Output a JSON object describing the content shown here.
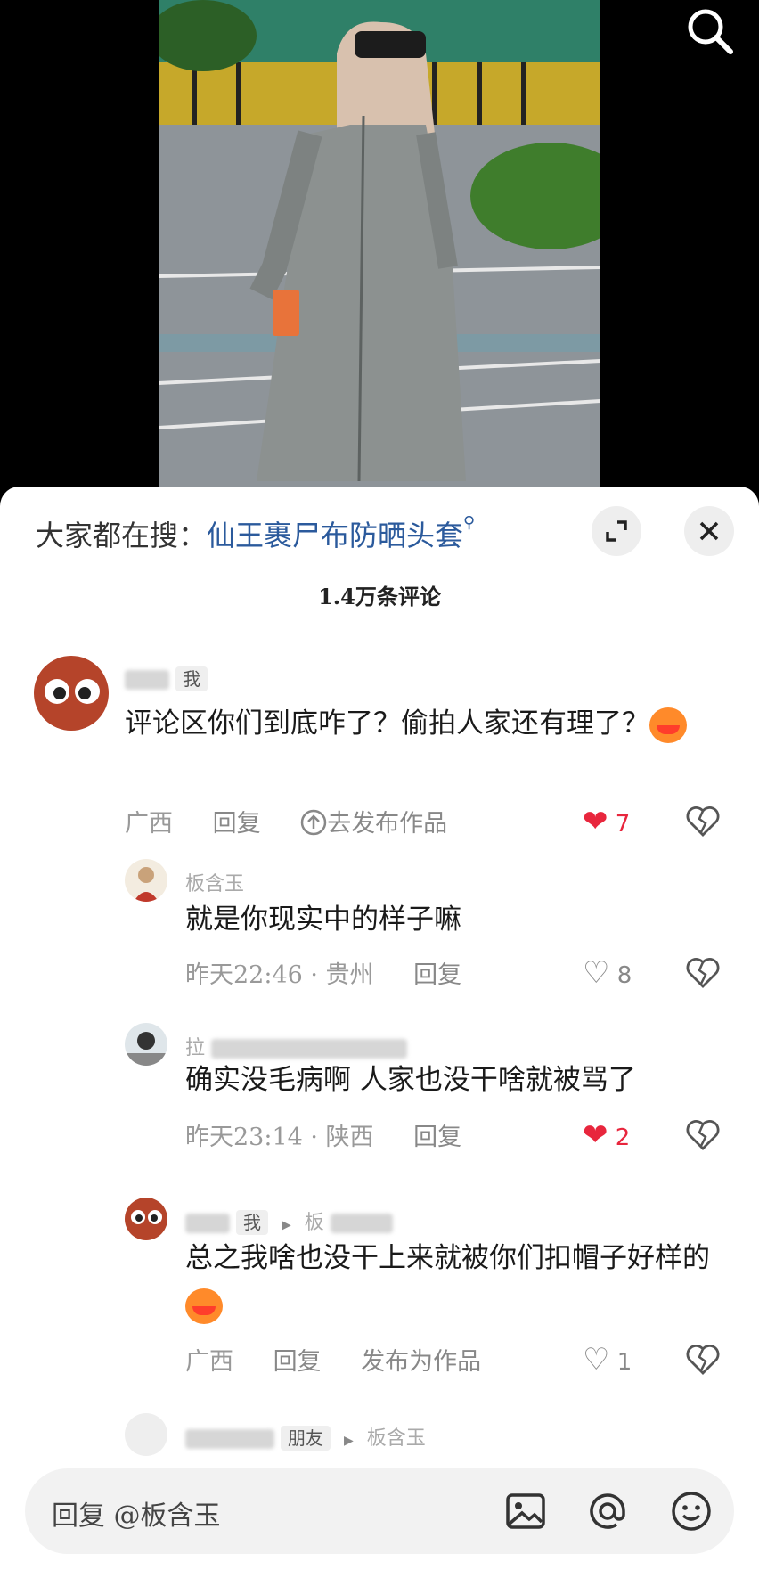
{
  "video": {
    "search_icon": "search-icon"
  },
  "sheet": {
    "trend_prefix": "大家都在搜：",
    "trend_keyword": "仙王裹尸布防晒头套",
    "comment_count": "1.4万条评论"
  },
  "comments": [
    {
      "tag": "我",
      "text": "评论区你们到底咋了？偷拍人家还有理了？",
      "location": "广西",
      "reply": "回复",
      "action": "去发布作品",
      "likes": "7",
      "liked": true
    },
    {
      "user": "板含玉",
      "text": "就是你现实中的样子嘛",
      "time": "昨天22:46 · 贵州",
      "reply": "回复",
      "likes": "8",
      "liked": false
    },
    {
      "user": "拉",
      "text": "确实没毛病啊 人家也没干啥就被骂了",
      "time": "昨天23:14 · 陕西",
      "reply": "回复",
      "likes": "2",
      "liked": true
    },
    {
      "tag": "我",
      "reply_to": "板",
      "text": "总之我啥也没干上来就被你们扣帽子好样的",
      "location": "广西",
      "reply": "回复",
      "action": "发布为作品",
      "likes": "1",
      "liked": false
    },
    {
      "tag": "朋友",
      "reply_to": "板含玉"
    }
  ],
  "input": {
    "placeholder": "回复 @板含玉"
  },
  "colors": {
    "like_red": "#e8263d",
    "link_blue": "#2b5a9c"
  }
}
